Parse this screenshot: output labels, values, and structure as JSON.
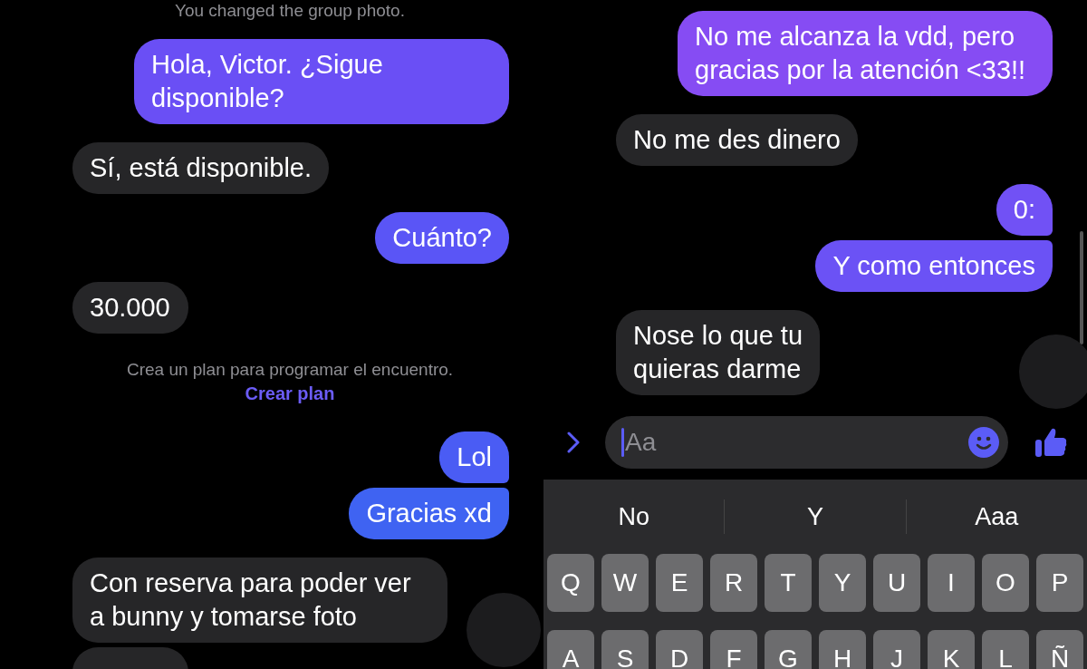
{
  "left_chat": {
    "messages": [
      {
        "kind": "system",
        "text": "You changed the group photo."
      },
      {
        "kind": "sent",
        "text": "Hola, Victor. ¿Sigue disponible?",
        "color": "#6a4ff5"
      },
      {
        "kind": "received",
        "text": "Sí, está disponible."
      },
      {
        "kind": "sent",
        "text": "Cuánto?",
        "color": "#5a55f6"
      },
      {
        "kind": "received",
        "text": "30.000"
      },
      {
        "kind": "system",
        "text": "Crea un plan para programar el encuentro.",
        "link": "Crear plan"
      },
      {
        "kind": "sent",
        "text": "Lol",
        "color": "#4a5cf4"
      },
      {
        "kind": "sent",
        "text": "Gracias xd",
        "color": "#3f63f2"
      },
      {
        "kind": "received",
        "text": "Con reserva para poder ver a bunny y tomarse foto"
      },
      {
        "kind": "received"
      }
    ]
  },
  "right_chat": {
    "messages": [
      {
        "kind": "sent",
        "text": "No me alcanza la vdd, pero gracias por la atención <33!!",
        "color": "#864cf3"
      },
      {
        "kind": "received",
        "text": "No me des dinero"
      },
      {
        "kind": "sent",
        "text": "0:",
        "color": "#7151f5"
      },
      {
        "kind": "sent",
        "text": "Y como entonces",
        "color": "#6b52f5"
      },
      {
        "kind": "received",
        "text": "Nose lo que tu\nquieras darme"
      }
    ],
    "composer": {
      "placeholder": "Aa"
    }
  },
  "keyboard": {
    "suggestions": [
      "No",
      "Y",
      "Aaa"
    ],
    "rows": [
      [
        "Q",
        "W",
        "E",
        "R",
        "T",
        "Y",
        "U",
        "I",
        "O",
        "P"
      ],
      [
        "A",
        "S",
        "D",
        "F",
        "G",
        "H",
        "J",
        "K",
        "L",
        "Ñ"
      ]
    ]
  }
}
